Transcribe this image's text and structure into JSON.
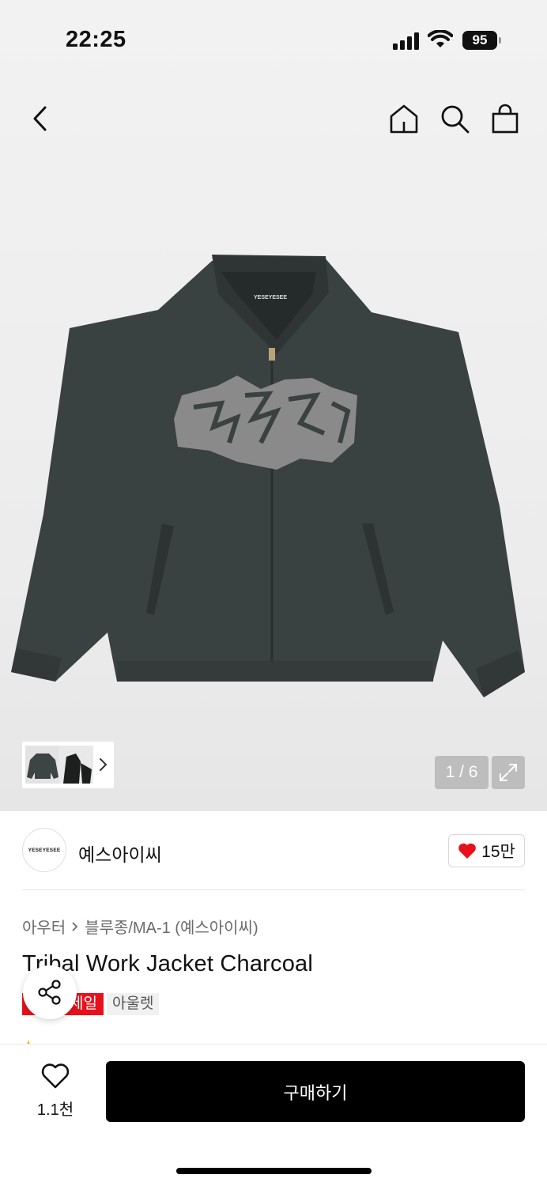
{
  "status": {
    "time": "22:25",
    "battery": "95"
  },
  "gallery": {
    "counter": "1 / 6"
  },
  "brand": {
    "logo_text": "YESEYESEE",
    "name": "예스아이씨",
    "likes": "15만"
  },
  "breadcrumb": {
    "category": "아우터",
    "subcategory": "블루종/MA-1 (예스아이씨)"
  },
  "product": {
    "title": "Tribal Work Jacket Charcoal",
    "tag_sale": "세일",
    "tag_outlet": "아울렛",
    "jacket_label": "YESEYESEE"
  },
  "bottom": {
    "wish_count": "1.1천",
    "buy_label": "구매하기"
  },
  "colors": {
    "accent_red": "#e8111b",
    "jacket": "#3a4141",
    "patch": "#8a8a8a"
  }
}
